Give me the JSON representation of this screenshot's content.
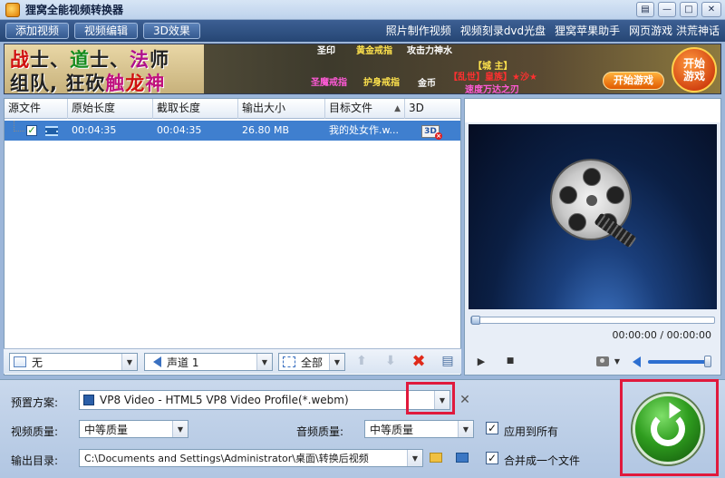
{
  "window": {
    "title": "狸窝全能视频转换器",
    "controls": [
      "▤",
      "—",
      "□",
      "✕"
    ]
  },
  "toolbar": {
    "buttons": [
      "添加视频",
      "视频编辑",
      "3D效果"
    ],
    "links": [
      "照片制作视频",
      "视频刻录dvd光盘",
      "狸窝苹果助手",
      "网页游戏 洪荒神话"
    ]
  },
  "banner": {
    "line1": [
      "战",
      "士、",
      "道",
      "士、",
      "法",
      "师"
    ],
    "line2": [
      "组队, 狂砍",
      "触",
      "龙",
      "神"
    ],
    "texts": [
      "圣印",
      "黄金戒指",
      "攻击力神水",
      "圣魔戒指",
      "护身戒指",
      "【城 主】",
      "【乱世】皇族】★沙★",
      "金币",
      "速度万达之刃"
    ],
    "start_button": "开始游戏",
    "start_circle": "开始\n游戏"
  },
  "file_list": {
    "columns": [
      "源文件",
      "原始长度",
      "截取长度",
      "输出大小",
      "目标文件",
      "3D"
    ],
    "rows": [
      {
        "checked": "✓",
        "original_length": "00:04:35",
        "clip_length": "00:04:35",
        "output_size": "26.80 MB",
        "target_file": "我的处女作.w...",
        "badge_3d": "3D"
      }
    ]
  },
  "list_controls": {
    "subtitle_value": "无",
    "audio_track_value": "声道 1",
    "selection_value": "全部"
  },
  "preview": {
    "time": "00:00:00 / 00:00:00",
    "play_icon": "play-icon",
    "stop_icon": "stop-icon"
  },
  "settings": {
    "preset_label": "预置方案:",
    "preset_value": "VP8 Video - HTML5 VP8 Video Profile(*.webm)",
    "video_quality_label": "视频质量:",
    "video_quality_value": "中等质量",
    "audio_quality_label": "音频质量:",
    "audio_quality_value": "中等质量",
    "apply_all_label": "应用到所有",
    "output_dir_label": "输出目录:",
    "output_dir_value": "C:\\Documents and Settings\\Administrator\\桌面\\转换后视频",
    "merge_label": "合并成一个文件",
    "check_mark": "✓",
    "highlight_color": "#e0193c"
  }
}
